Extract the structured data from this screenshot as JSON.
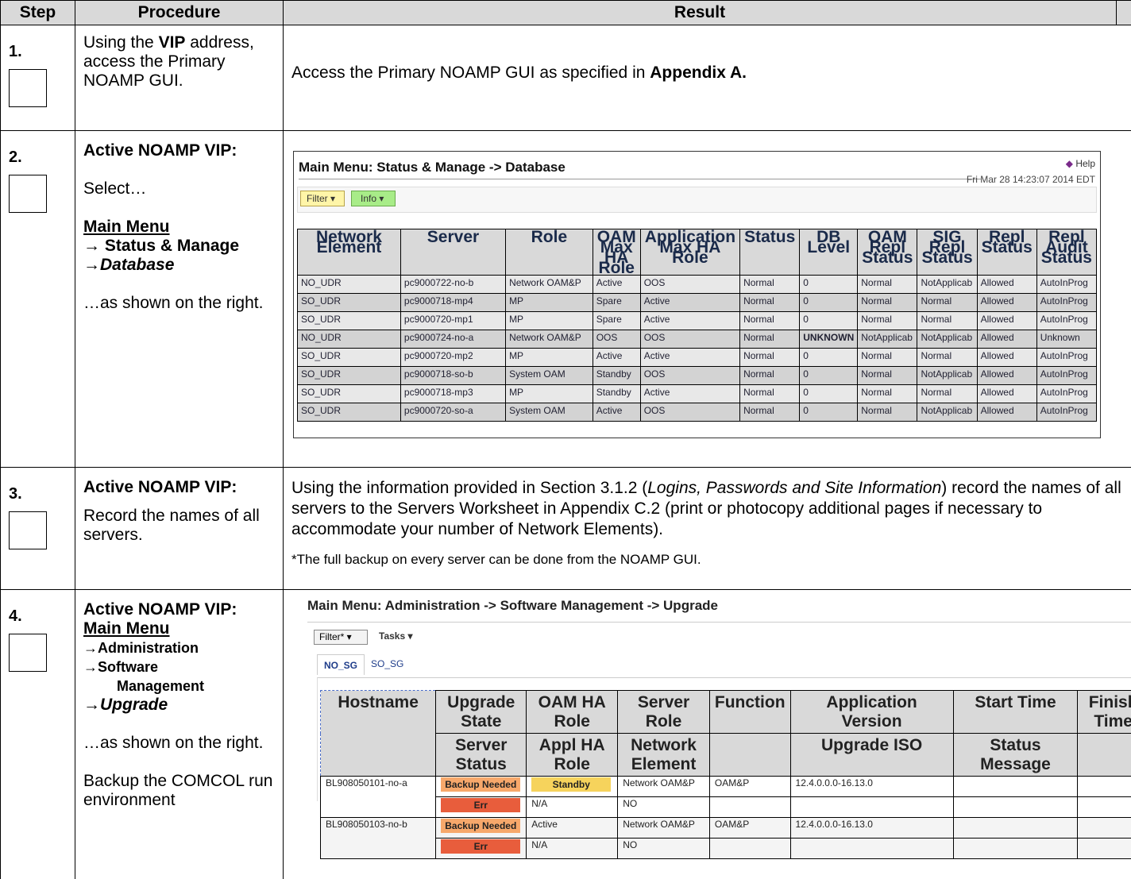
{
  "headers": {
    "step": "Step",
    "procedure": "Procedure",
    "result": "Result"
  },
  "steps": [
    {
      "num": "1.",
      "proc_a": "Using the ",
      "proc_b": "VIP",
      "proc_c": " address, access the Primary NOAMP GUI.",
      "result_a": "Access the Primary NOAMP GUI as specified in ",
      "result_b": "Appendix A."
    },
    {
      "num": "2.",
      "proc_title": "Active NOAMP VIP:",
      "proc_select": "Select…",
      "menu1": "Main Menu",
      "menu2": "→ Status & Manage",
      "menu3": "→Database",
      "proc_tail": "…as shown on the right."
    },
    {
      "num": "3.",
      "proc_title": "Active NOAMP VIP:",
      "proc_text": "Record the names of all servers.",
      "r1": "Using the information provided in Section 3.1.2 (",
      "r2": "Logins, Passwords and Site Information",
      "r3": ") record the names of all servers to the Servers Worksheet in Appendix C.2 (print or photocopy additional pages if necessary to accommodate your number of Network Elements).",
      "r4": "*The full backup on every server can be done from the NOAMP GUI."
    },
    {
      "num": "4.",
      "proc_title": "Active NOAMP VIP:",
      "menu1": "Main Menu",
      "menu2": "→Administration",
      "menu3": "→Software",
      "menu3b": "Management",
      "menu4": "→Upgrade",
      "proc_tail": "…as shown on the right.",
      "proc_backup": "Backup the COMCOL run environment"
    }
  ],
  "db_screen": {
    "title": "Main Menu: Status & Manage -> Database",
    "help": "Help",
    "datetime": "Fri Mar 28 14:23:07 2014 EDT",
    "filter": "Filter ▾",
    "info": "Info ▾",
    "columns": [
      "Network Element",
      "Server",
      "Role",
      "OAM Max HA Role",
      "Application Max HA Role",
      "Status",
      "DB Level",
      "OAM Repl Status",
      "SIG Repl Status",
      "Repl Status",
      "Repl Audit Status"
    ],
    "rows": [
      [
        "NO_UDR",
        "pc9000722-no-b",
        "Network OAM&P",
        "Active",
        "OOS",
        "Normal",
        "0",
        "Normal",
        "NotApplicab",
        "Allowed",
        "AutoInProg"
      ],
      [
        "SO_UDR",
        "pc9000718-mp4",
        "MP",
        "Spare",
        "Active",
        "Normal",
        "0",
        "Normal",
        "Normal",
        "Allowed",
        "AutoInProg"
      ],
      [
        "SO_UDR",
        "pc9000720-mp1",
        "MP",
        "Spare",
        "Active",
        "Normal",
        "0",
        "Normal",
        "Normal",
        "Allowed",
        "AutoInProg"
      ],
      [
        "NO_UDR",
        "pc9000724-no-a",
        "Network OAM&P",
        "OOS",
        "OOS",
        "Normal",
        "UNKNOWN",
        "NotApplicab",
        "NotApplicab",
        "Allowed",
        "Unknown"
      ],
      [
        "SO_UDR",
        "pc9000720-mp2",
        "MP",
        "Active",
        "Active",
        "Normal",
        "0",
        "Normal",
        "Normal",
        "Allowed",
        "AutoInProg"
      ],
      [
        "SO_UDR",
        "pc9000718-so-b",
        "System OAM",
        "Standby",
        "OOS",
        "Normal",
        "0",
        "Normal",
        "NotApplicab",
        "Allowed",
        "AutoInProg"
      ],
      [
        "SO_UDR",
        "pc9000718-mp3",
        "MP",
        "Standby",
        "Active",
        "Normal",
        "0",
        "Normal",
        "Normal",
        "Allowed",
        "AutoInProg"
      ],
      [
        "SO_UDR",
        "pc9000720-so-a",
        "System OAM",
        "Active",
        "OOS",
        "Normal",
        "0",
        "Normal",
        "NotApplicab",
        "Allowed",
        "AutoInProg"
      ]
    ]
  },
  "upgrade_screen": {
    "title": "Main Menu: Administration -> Software Management -> Upgrade",
    "filter": "Filter* ▾",
    "tasks": "Tasks ▾",
    "tabs": [
      "NO_SG",
      "SO_SG"
    ],
    "hostname_header": "Hostname",
    "header1": [
      "Upgrade State",
      "OAM HA Role",
      "Server Role",
      "Function",
      "Application Version",
      "Start Time",
      "Finish Time"
    ],
    "header2": [
      "Server Status",
      "Appl HA Role",
      "Network Element",
      "",
      "Upgrade ISO",
      "Status Message",
      ""
    ],
    "servers": [
      {
        "host": "BL908050101-no-a",
        "state": "Backup Needed",
        "oam_ha": "Standby",
        "server_role": "Network OAM&P",
        "function": "OAM&P",
        "version": "12.4.0.0.0-16.13.0",
        "status": "Err",
        "appl_ha": "N/A",
        "ne": "NO"
      },
      {
        "host": "BL908050103-no-b",
        "state": "Backup Needed",
        "oam_ha": "Active",
        "server_role": "Network OAM&P",
        "function": "OAM&P",
        "version": "12.4.0.0.0-16.13.0",
        "status": "Err",
        "appl_ha": "N/A",
        "ne": "NO"
      }
    ]
  }
}
